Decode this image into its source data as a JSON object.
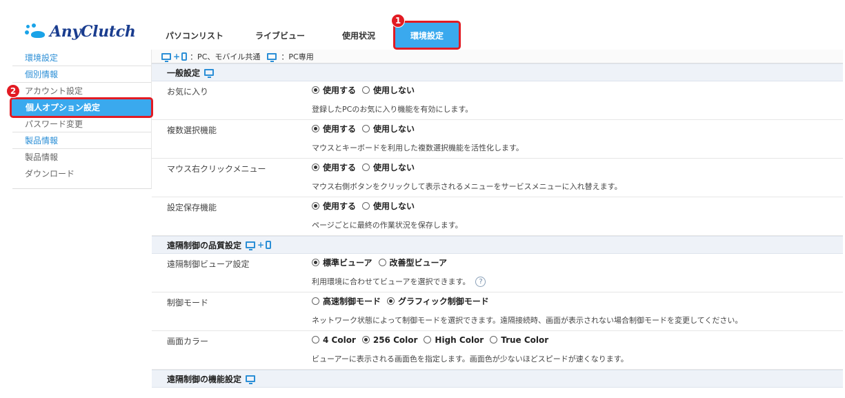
{
  "brand": {
    "name": "AnyClutch"
  },
  "tabs": [
    {
      "label": "パソコンリスト"
    },
    {
      "label": "ライブビュー"
    },
    {
      "label": "使用状況"
    },
    {
      "label": "環境設定"
    }
  ],
  "badges": {
    "one": "1",
    "two": "2"
  },
  "sidebar": {
    "items": [
      {
        "label": "環境設定"
      },
      {
        "label": "個別情報"
      },
      {
        "label": "アカウント設定"
      },
      {
        "label": "個人オプション設定"
      },
      {
        "label": "パスワード変更"
      },
      {
        "label": "製品情報"
      },
      {
        "label": "製品情報"
      },
      {
        "label": "ダウンロード"
      }
    ]
  },
  "legend": {
    "both": "：PC、モバイル共通",
    "pc": "：PC専用"
  },
  "sections": [
    {
      "title": "一般設定",
      "rows": [
        {
          "label": "お気に入り",
          "options": [
            "使用する",
            "使用しない"
          ],
          "selected": 0,
          "desc": "登録したPCのお気に入り機能を有効にします。"
        },
        {
          "label": "複数選択機能",
          "options": [
            "使用する",
            "使用しない"
          ],
          "selected": 0,
          "desc": "マウスとキーボードを利用した複数選択機能を活性化します。"
        },
        {
          "label": "マウス右クリックメニュー",
          "options": [
            "使用する",
            "使用しない"
          ],
          "selected": 0,
          "desc": "マウス右側ボタンをクリックして表示されるメニューをサービスメニューに入れ替えます。"
        },
        {
          "label": "設定保存機能",
          "options": [
            "使用する",
            "使用しない"
          ],
          "selected": 0,
          "desc": "ページごとに最終の作業状況を保存します。"
        }
      ]
    },
    {
      "title": "遠隔制御の品質設定",
      "rows": [
        {
          "label": "遠隔制御ビューア設定",
          "options": [
            "標準ビューア",
            "改善型ビューア"
          ],
          "selected": 0,
          "desc": "利用環境に合わせてビューアを選択できます。",
          "help": "?"
        },
        {
          "label": "制御モード",
          "options": [
            "高速制御モード",
            "グラフィック制御モード"
          ],
          "selected": 1,
          "desc": "ネットワーク状態によって制御モードを選択できます。遠隔接続時、画面が表示されない場合制御モードを変更してください。"
        },
        {
          "label": "画面カラー",
          "options": [
            "4 Color",
            "256 Color",
            "High Color",
            "True Color"
          ],
          "selected": 1,
          "desc": "ビューアーに表示される画面色を指定します。画面色が少ないほどスピードが速くなります。"
        }
      ]
    },
    {
      "title": "遠隔制御の機能設定",
      "rows": []
    }
  ],
  "colors": {
    "accent": "#3aa9ee",
    "highlight": "#e21b23",
    "brand": "#1a3d8f"
  }
}
